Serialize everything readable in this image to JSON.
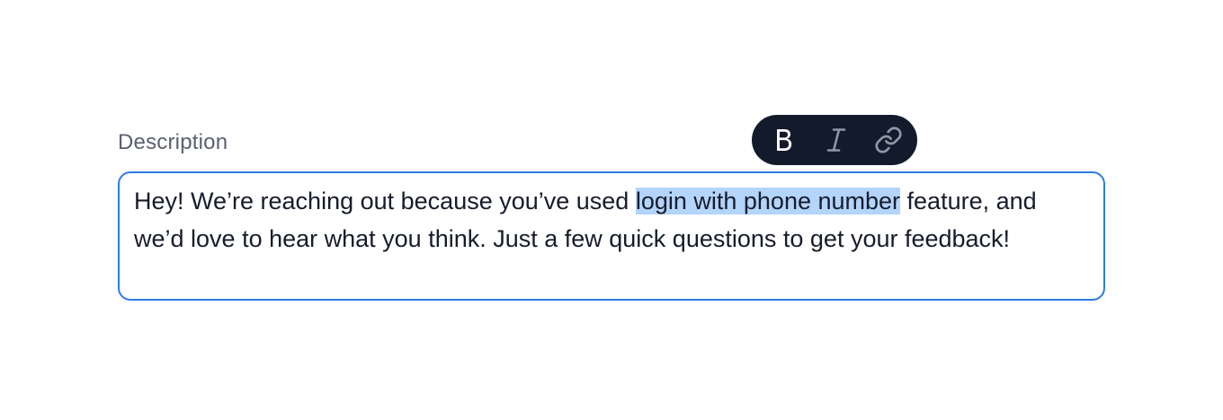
{
  "field": {
    "label": "Description"
  },
  "toolbar": {
    "items": [
      {
        "name": "bold",
        "icon": "bold-icon"
      },
      {
        "name": "italic",
        "icon": "italic-icon"
      },
      {
        "name": "link",
        "icon": "link-icon"
      }
    ],
    "background": "#131a2b"
  },
  "editor": {
    "text_before": "Hey! We’re reaching out because you’ve used ",
    "selected_text": "login with phone number",
    "text_after": " feature, and we’d love to hear what you think. Just a few quick questions to get your feedback!",
    "border_color": "#2f7ae5",
    "selection_color": "#b3d4fb"
  }
}
